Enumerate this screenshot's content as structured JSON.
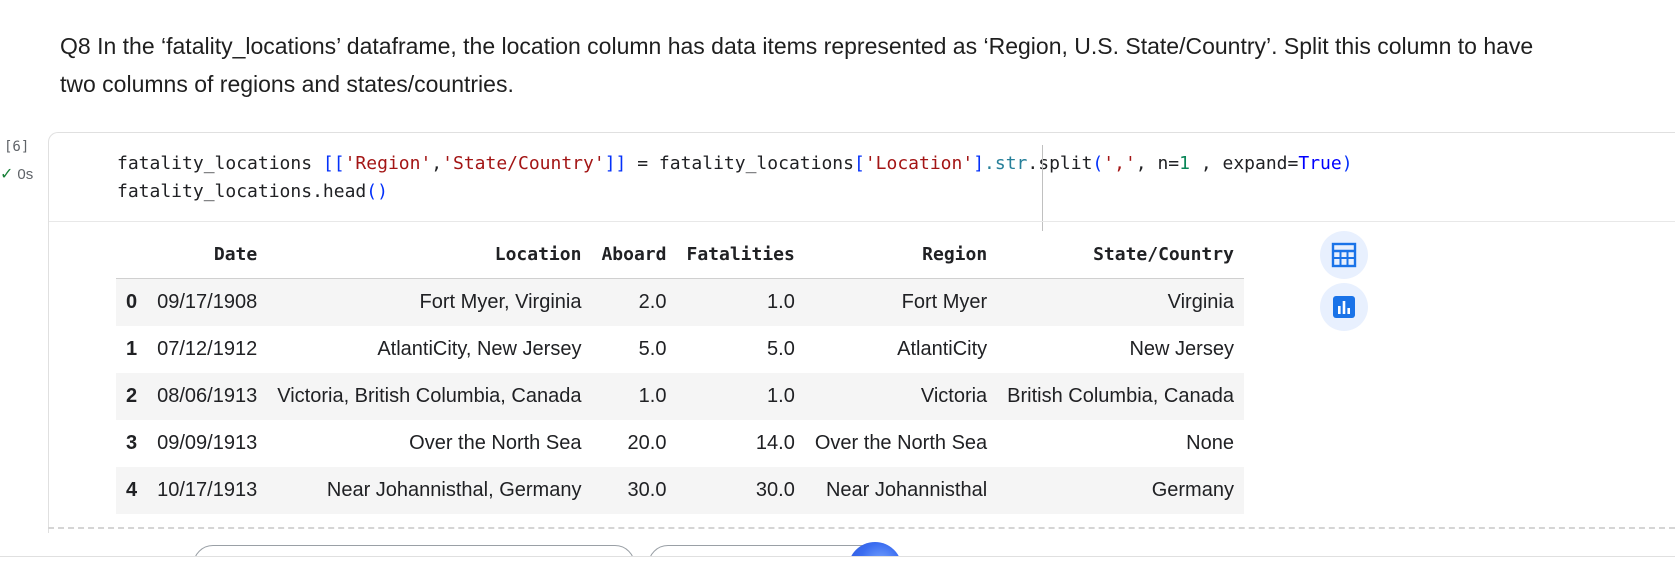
{
  "markdown": {
    "question": "Q8 In the ‘fatality_locations’ dataframe, the location column has data items represented as ‘Region, U.S. State/Country’. Split this column to have two columns of regions and states/countries."
  },
  "cell": {
    "execution_count": "[6]",
    "status_time": "0s",
    "status_icon": "check-icon",
    "code": {
      "l1_var": "fatality_locations ",
      "l1_b1": "[[",
      "l1_s1": "'Region'",
      "l1_comma1": ",",
      "l1_s2": "'State/Country'",
      "l1_b2": "]]",
      "l1_eq": " = fatality_locations",
      "l1_b3": "[",
      "l1_s3": "'Location'",
      "l1_b4": "]",
      "l1_attr": ".str",
      "l1_method": ".split",
      "l1_p1": "(",
      "l1_s4": "','",
      "l1_n": ", n=",
      "l1_num": "1",
      "l1_exp": " , expand=",
      "l1_kw": "True",
      "l1_p2": ")",
      "l2_text": "fatality_locations.head",
      "l2_paren": "()"
    }
  },
  "dataframe": {
    "columns": [
      "",
      "Date",
      "Location",
      "Aboard",
      "Fatalities",
      "Region",
      "State/Country"
    ],
    "rows": [
      [
        "0",
        "09/17/1908",
        "Fort Myer, Virginia",
        "2.0",
        "1.0",
        "Fort Myer",
        "Virginia"
      ],
      [
        "1",
        "07/12/1912",
        "AtlantiCity, New Jersey",
        "5.0",
        "5.0",
        "AtlantiCity",
        "New Jersey"
      ],
      [
        "2",
        "08/06/1913",
        "Victoria, British Columbia, Canada",
        "1.0",
        "1.0",
        "Victoria",
        "British Columbia, Canada"
      ],
      [
        "3",
        "09/09/1913",
        "Over the North Sea",
        "20.0",
        "14.0",
        "Over the North Sea",
        "None"
      ],
      [
        "4",
        "10/17/1913",
        "Near Johannisthal, Germany",
        "30.0",
        "30.0",
        "Near Johannisthal",
        "Germany"
      ]
    ]
  },
  "side_buttons": [
    {
      "icon": "table-icon"
    },
    {
      "icon": "bar-chart-icon"
    }
  ],
  "colors": {
    "accent": "#1a73e8",
    "button_bg": "#e8f0fe",
    "row_alt": "#f5f5f5"
  }
}
